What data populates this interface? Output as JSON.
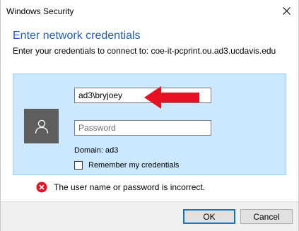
{
  "window": {
    "title": "Windows Security",
    "close_icon": "close-icon"
  },
  "dialog": {
    "heading": "Enter network credentials",
    "subheading": "Enter your credentials to connect to: coe-it-pcprint.ou.ad3.ucdavis.edu"
  },
  "credentials": {
    "username_value": "ad3\\bryjoey",
    "password_placeholder": "Password",
    "domain": "Domain: ad3",
    "remember_label": "Remember my credentials",
    "remember_checked": false,
    "avatar_icon": "user-icon",
    "arrow_color": "#e81123"
  },
  "error": {
    "icon": "error-icon",
    "message": "The user name or password is incorrect.",
    "color": "#e81123"
  },
  "buttons": {
    "ok": "OK",
    "cancel": "Cancel"
  },
  "colors": {
    "heading": "#1f5fbf",
    "panel_bg": "#cce8ff",
    "accent": "#0078d7"
  }
}
